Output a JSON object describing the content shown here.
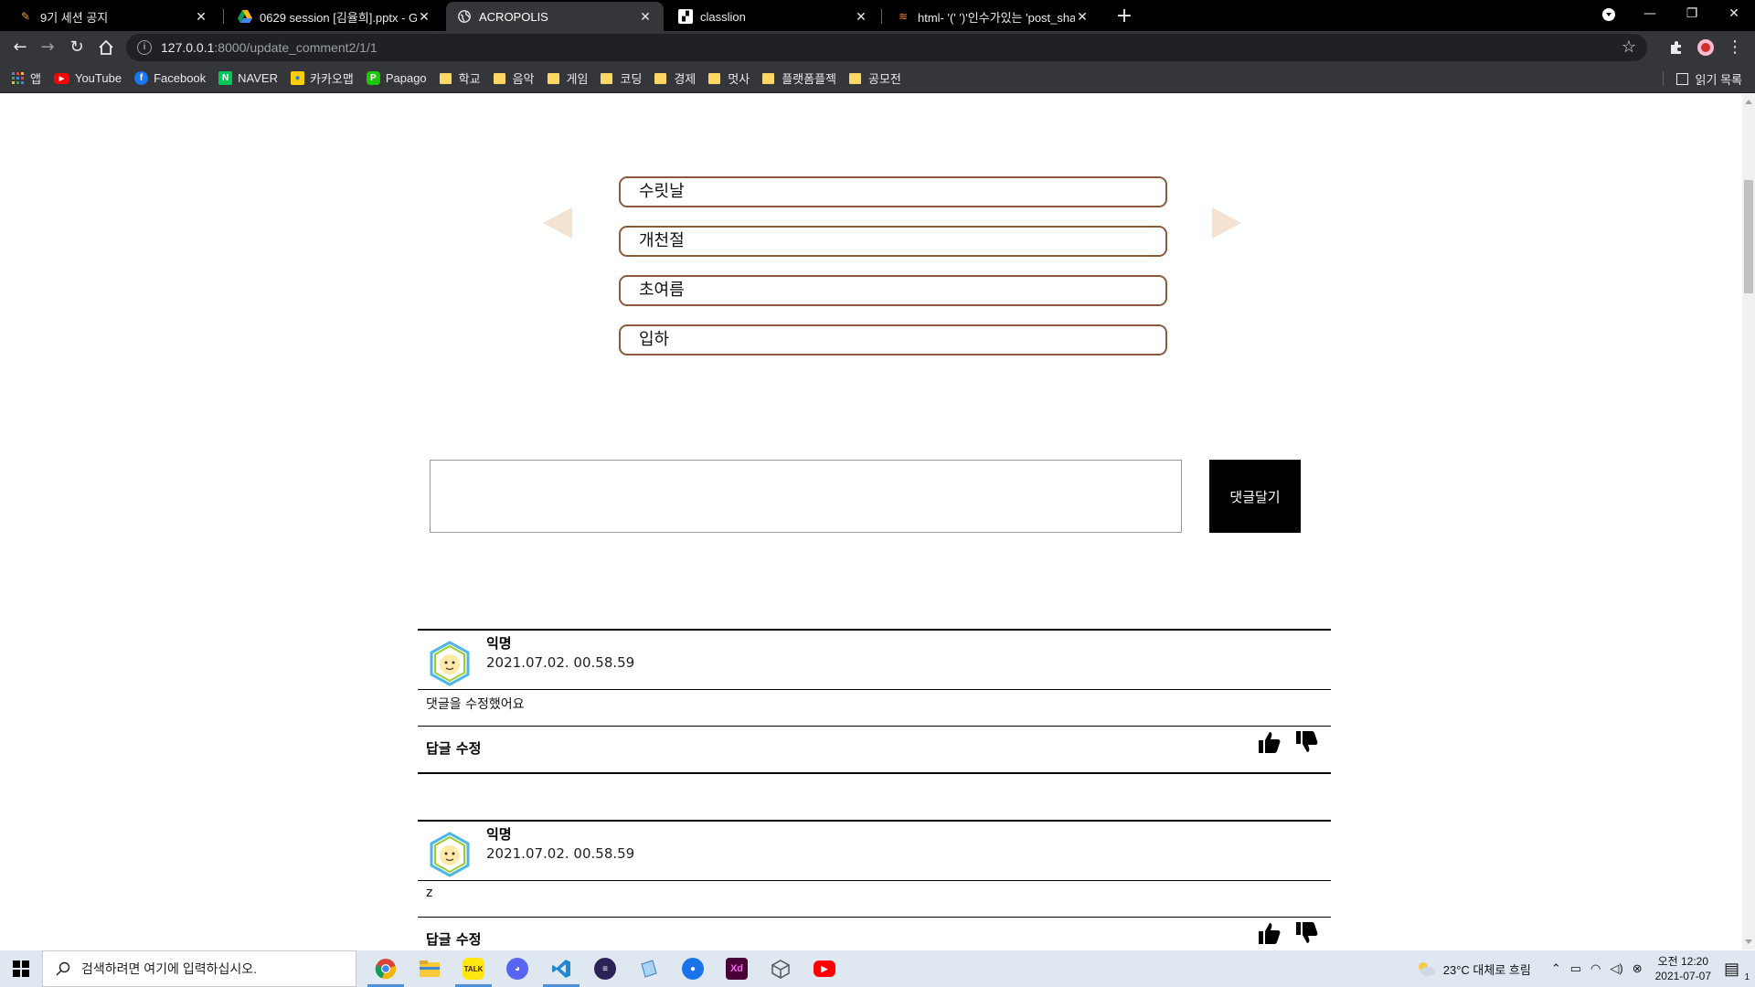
{
  "browser": {
    "tabs": [
      {
        "title": "9기 세션 공지",
        "favicon": "pencil-icon",
        "active": false
      },
      {
        "title": "0629 session [김율희].pptx - Go",
        "favicon": "google-drive-icon",
        "active": false
      },
      {
        "title": "ACROPOLIS",
        "favicon": "globe-icon",
        "active": true
      },
      {
        "title": "classlion",
        "favicon": "classlion-icon",
        "active": false
      },
      {
        "title": "html- '(' ')'인수가있는 'post_sha",
        "favicon": "stackoverflow-icon",
        "active": false
      }
    ],
    "url_host": "127.0.0.1",
    "url_path": ":8000/update_comment2/1/1",
    "bookmarks": [
      {
        "label": "앱",
        "icon": "apps-grid-icon",
        "color": "#e8eaed"
      },
      {
        "label": "YouTube",
        "icon": "youtube-icon",
        "color": "#ff0000"
      },
      {
        "label": "Facebook",
        "icon": "facebook-icon",
        "color": "#1877f2"
      },
      {
        "label": "NAVER",
        "icon": "naver-icon",
        "color": "#03c75a"
      },
      {
        "label": "카카오맵",
        "icon": "kakaomap-icon",
        "color": "#ffcd00"
      },
      {
        "label": "Papago",
        "icon": "papago-icon",
        "color": "#1ec800"
      },
      {
        "label": "학교",
        "icon": "folder-icon"
      },
      {
        "label": "음악",
        "icon": "folder-icon"
      },
      {
        "label": "게임",
        "icon": "folder-icon"
      },
      {
        "label": "코딩",
        "icon": "folder-icon"
      },
      {
        "label": "경제",
        "icon": "folder-icon"
      },
      {
        "label": "멋사",
        "icon": "folder-icon"
      },
      {
        "label": "플랫폼플젝",
        "icon": "folder-icon"
      },
      {
        "label": "공모전",
        "icon": "folder-icon"
      }
    ],
    "reading_list": "읽기 목록"
  },
  "quiz": {
    "options": [
      "수릿날",
      "개천절",
      "초여름",
      "입하"
    ],
    "accent_color": "#8b5a3c",
    "arrow_color": "#f4e3d3"
  },
  "comment_form": {
    "input_value": "",
    "submit_label": "댓글달기"
  },
  "comments": [
    {
      "author": "익명",
      "date": "2021.07.02. 00.58.59",
      "body": "댓글을 수정했어요",
      "actions": "답글 수정"
    },
    {
      "author": "익명",
      "date": "2021.07.02. 00.58.59",
      "body": "z",
      "actions": "답글 수정"
    }
  ],
  "taskbar": {
    "search_placeholder": "검색하려면 여기에 입력하십시오.",
    "weather": "23°C  대체로 흐림",
    "time": "오전 12:20",
    "date": "2021-07-07",
    "notification_count": "1"
  }
}
